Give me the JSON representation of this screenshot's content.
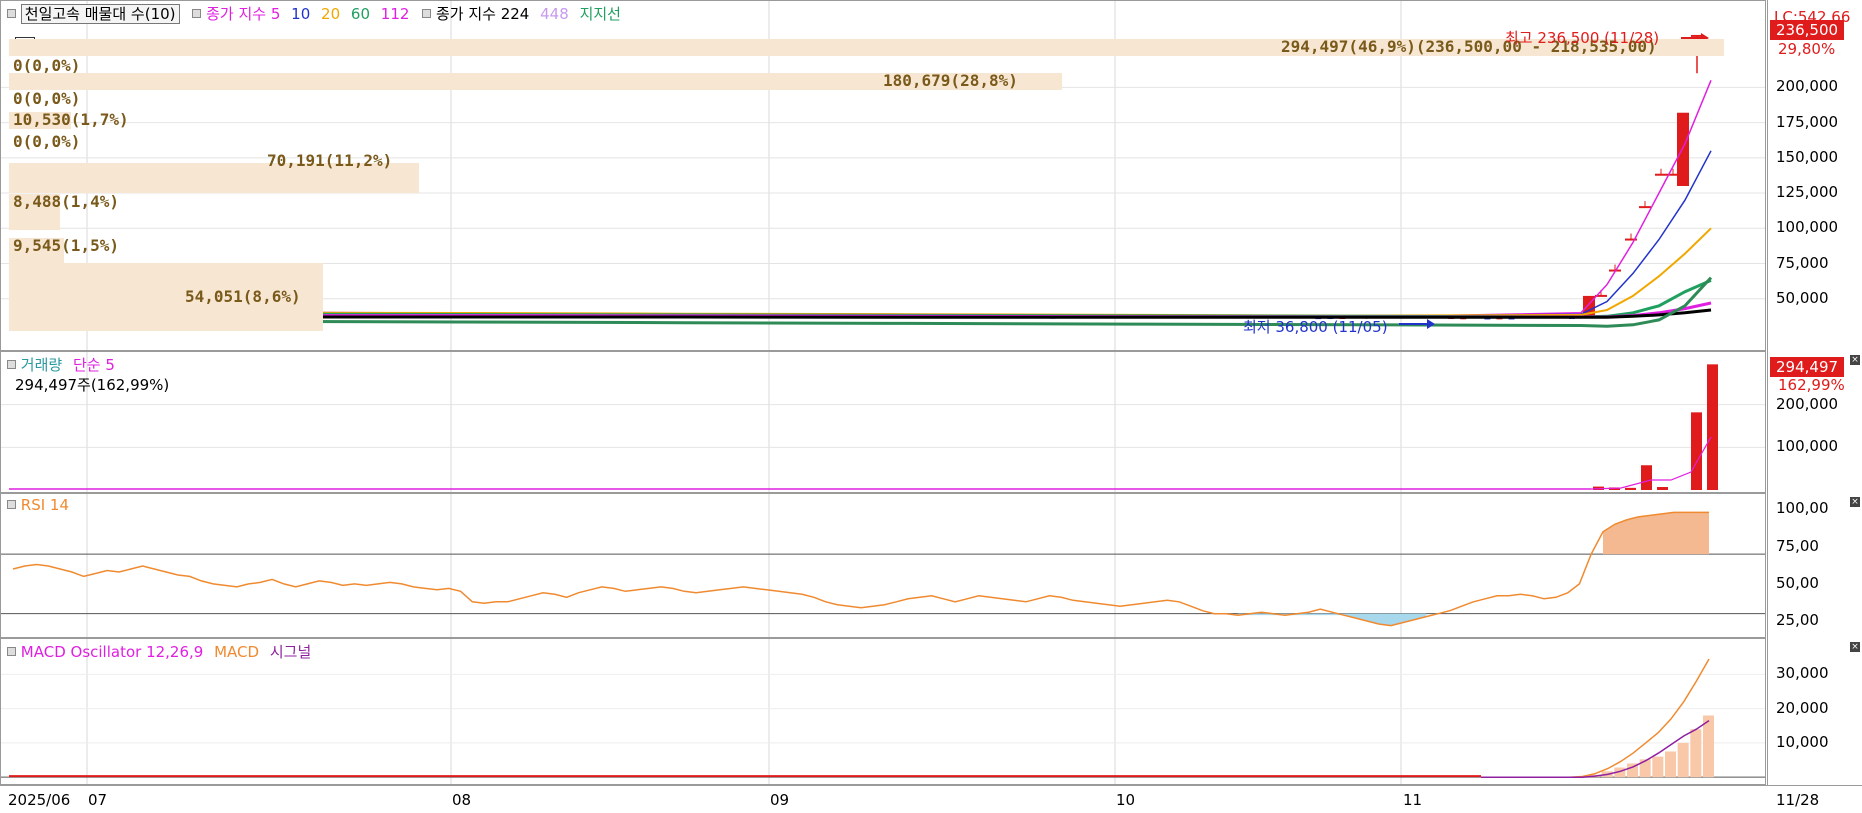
{
  "price_pane": {
    "legend": {
      "title": "천일고속 매물대 수(10)",
      "ma_label": "종가 지수",
      "ma": [
        {
          "label": "5",
          "color": "#e020e0"
        },
        {
          "label": "10",
          "color": "#2233cc"
        },
        {
          "label": "20",
          "color": "#f0a800"
        },
        {
          "label": "60",
          "color": "#20a060"
        },
        {
          "label": "112",
          "color": "#e020e0"
        }
      ],
      "ma2_label": "종가 지수 224",
      "ma2_extra": "448",
      "support": "지지선"
    },
    "volume_profile": [
      {
        "label": "294,497(46,9%)(236,500,00 - 218,535,00)",
        "frac": 0.469
      },
      {
        "label": "0(0,0%)",
        "frac": 0.0
      },
      {
        "label": "180,679(28,8%)",
        "frac": 0.288
      },
      {
        "label": "0(0,0%)",
        "frac": 0.0
      },
      {
        "label": "10,530(1,7%)",
        "frac": 0.017
      },
      {
        "label": "0(0,0%)",
        "frac": 0.0
      },
      {
        "label": "70,191(11,2%)",
        "frac": 0.112
      },
      {
        "label": "8,488(1,4%)",
        "frac": 0.014
      },
      {
        "label": "9,545(1,5%)",
        "frac": 0.015
      },
      {
        "label": "54,051(8,6%)",
        "frac": 0.086
      }
    ],
    "high_label": "최고 236,500 (11/28)",
    "low_label": "최저 36,800 (11/05)",
    "y_ticks": [
      "200,000",
      "175,000",
      "150,000",
      "125,000",
      "100,000",
      "75,000",
      "50,000"
    ],
    "y_tick_values": [
      200000,
      175000,
      150000,
      125000,
      100000,
      75000,
      50000
    ],
    "top_labels": {
      "lc": "LC:542,66",
      "price": "236,500",
      "pct": "29,80%"
    }
  },
  "volume_pane": {
    "legend": {
      "title": "거래량",
      "ma": "단순 5"
    },
    "current": "294,497주(162,99%)",
    "y_ticks": [
      "200,000",
      "100,000"
    ],
    "y_tick_values": [
      200000,
      100000
    ],
    "tag": "294,497",
    "tag_pct": "162,99%"
  },
  "rsi_pane": {
    "legend": {
      "title": "RSI 14"
    },
    "y_ticks": [
      "100,00",
      "75,00",
      "50,00",
      "25,00"
    ],
    "y_tick_values": [
      100,
      75,
      50,
      25
    ],
    "overbought": 70,
    "oversold": 30
  },
  "macd_pane": {
    "legend": {
      "title": "MACD Oscillator 12,26,9",
      "macd": "MACD",
      "signal": "시그널"
    },
    "y_ticks": [
      "30,000",
      "20,000",
      "10,000"
    ],
    "y_tick_values": [
      30000,
      20000,
      10000
    ]
  },
  "x_axis": {
    "labels": [
      "2025/06",
      "07",
      "08",
      "09",
      "10",
      "11"
    ],
    "end_label": "11/28"
  },
  "colors": {
    "up": "#e01b1b",
    "down": "#2233cc",
    "rsi": "#f08a30",
    "rsi_fill": "#f4b990",
    "macd_bar": "#f8c8a8"
  },
  "chart_data": [
    {
      "type": "line",
      "title": "천일고속 매물대 수(10)",
      "series": [
        {
          "name": "종가 지수 5",
          "values": [
            40000,
            40500,
            39800,
            39000,
            38500,
            37800,
            37000,
            40000,
            60000,
            90000,
            125000,
            160000,
            205000
          ]
        },
        {
          "name": "종가 지수 10",
          "values": [
            40000,
            40200,
            39900,
            39200,
            38800,
            38200,
            37500,
            39000,
            48000,
            68000,
            92000,
            120000,
            155000
          ]
        },
        {
          "name": "종가 지수 20",
          "values": [
            40000,
            40100,
            39900,
            39400,
            39000,
            38500,
            38000,
            38500,
            42000,
            52000,
            66000,
            82000,
            100000
          ]
        },
        {
          "name": "종가 지수 60",
          "values": [
            39000,
            39000,
            38800,
            38500,
            38200,
            37800,
            37500,
            37000,
            37500,
            40000,
            45000,
            55000,
            63000
          ]
        },
        {
          "name": "종가 지수 112",
          "values": [
            38000,
            38000,
            38000,
            37800,
            37500,
            37200,
            37000,
            37000,
            37000,
            38000,
            40000,
            43000,
            47000
          ]
        },
        {
          "name": "종가 지수 224",
          "values": [
            37000,
            37000,
            37000,
            37000,
            36800,
            36800,
            36800,
            36800,
            36800,
            37500,
            38500,
            40000,
            42000
          ]
        },
        {
          "name": "지지선",
          "values": [
            34000,
            34000,
            33500,
            33000,
            32500,
            32000,
            31500,
            31000,
            30500,
            31500,
            35000,
            45000,
            65000
          ]
        }
      ],
      "highlights": {
        "high": 236500,
        "low": 36800
      },
      "ylim": [
        20000,
        240000
      ]
    },
    {
      "type": "bar",
      "title": "거래량",
      "series": [
        {
          "name": "거래량",
          "values": [
            294497
          ]
        }
      ],
      "ylim": [
        0,
        300000
      ]
    },
    {
      "type": "line",
      "title": "RSI 14",
      "ylim": [
        15,
        105
      ],
      "values": [
        60,
        62,
        63,
        62,
        60,
        58,
        55,
        57,
        59,
        58,
        60,
        62,
        60,
        58,
        56,
        55,
        52,
        50,
        49,
        48,
        50,
        51,
        53,
        50,
        48,
        50,
        52,
        51,
        49,
        50,
        49,
        50,
        51,
        50,
        48,
        47,
        46,
        47,
        45,
        38,
        37,
        38,
        38,
        40,
        42,
        44,
        43,
        41,
        44,
        46,
        48,
        47,
        45,
        46,
        47,
        48,
        47,
        45,
        44,
        45,
        46,
        47,
        48,
        47,
        46,
        45,
        44,
        43,
        41,
        38,
        36,
        35,
        34,
        35,
        36,
        38,
        40,
        41,
        42,
        40,
        38,
        40,
        42,
        41,
        40,
        39,
        38,
        40,
        42,
        41,
        39,
        38,
        37,
        36,
        35,
        36,
        37,
        38,
        39,
        38,
        35,
        32,
        30,
        30,
        29,
        30,
        31,
        30,
        29,
        30,
        31,
        33,
        31,
        29,
        27,
        25,
        23,
        22,
        24,
        26,
        28,
        30,
        32,
        35,
        38,
        40,
        42,
        42,
        43,
        42,
        40,
        41,
        44,
        50,
        70,
        85,
        90,
        93,
        95,
        96,
        97,
        98,
        98,
        98,
        98
      ]
    },
    {
      "type": "line",
      "title": "MACD Oscillator 12,26,9",
      "ylim": [
        -2000,
        38000
      ],
      "series": [
        {
          "name": "MACD",
          "values": [
            0,
            0,
            0,
            0,
            0,
            0,
            0,
            0,
            200,
            1000,
            2500,
            4500,
            7000,
            10000,
            13000,
            17000,
            22000,
            28000,
            34500
          ]
        },
        {
          "name": "시그널",
          "values": [
            0,
            0,
            0,
            0,
            0,
            0,
            0,
            0,
            0,
            300,
            800,
            1700,
            3000,
            4800,
            7000,
            9500,
            12000,
            14000,
            16500
          ]
        }
      ],
      "bars": [
        0,
        0,
        0,
        0,
        0,
        0,
        0,
        0,
        200,
        700,
        1700,
        2800,
        4000,
        5200,
        6000,
        7500,
        10000,
        14000,
        18000
      ]
    }
  ]
}
